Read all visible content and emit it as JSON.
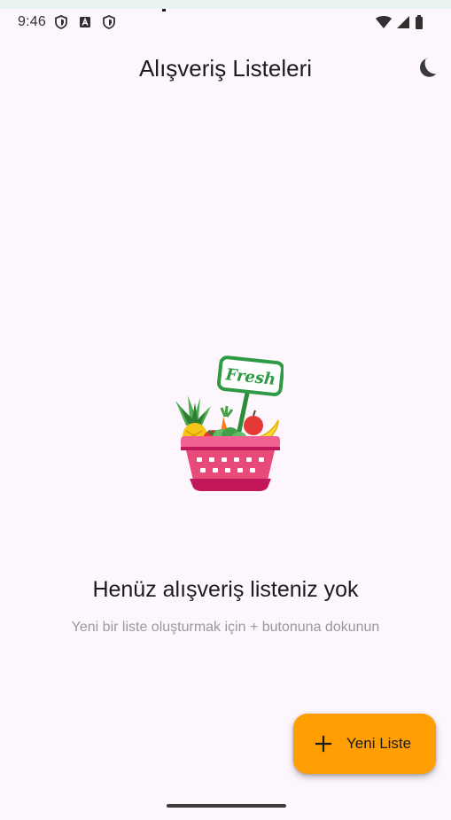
{
  "status_bar": {
    "time": "9:46",
    "icons": [
      "shield-icon",
      "font-a-icon",
      "shield-icon",
      "wifi-icon",
      "cell-signal-icon",
      "battery-icon"
    ]
  },
  "app_bar": {
    "title": "Alışveriş Listeleri",
    "theme_toggle_icon": "dark-mode-moon-icon"
  },
  "empty_state": {
    "illustration": "fresh-produce-basket",
    "sign_text": "Fresh",
    "title": "Henüz alışveriş listeniz yok",
    "subtitle": "Yeni bir liste oluşturmak için + butonuna dokunun"
  },
  "fab": {
    "icon": "plus-icon",
    "label": "Yeni Liste",
    "color": "#ff9e03"
  },
  "colors": {
    "background": "#fdf7fd",
    "basket": "#e84a7a",
    "accent": "#ff9e03"
  }
}
